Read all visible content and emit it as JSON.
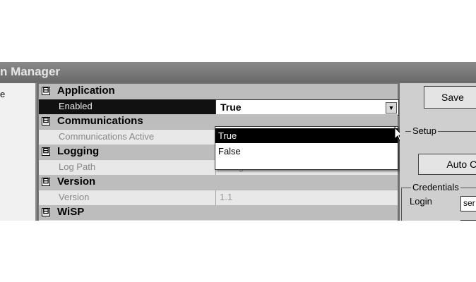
{
  "window": {
    "title": "n Manager"
  },
  "left_panel": {
    "text": "e"
  },
  "grid": {
    "categories": [
      {
        "name": "Application",
        "expander": "⊟"
      },
      {
        "name": "Communications",
        "expander": "⊟"
      },
      {
        "name": "Logging",
        "expander": "⊟"
      },
      {
        "name": "Version",
        "expander": "⊟"
      },
      {
        "name": "WiSP",
        "expander": "⊟"
      }
    ],
    "properties": {
      "enabled": {
        "name": "Enabled",
        "value": "True"
      },
      "communications_active": {
        "name": "Communications Active",
        "value": ""
      },
      "log_path": {
        "name": "Log Path",
        "value": "D:\\logs"
      },
      "version": {
        "name": "Version",
        "value": "1.1"
      }
    },
    "dropdown": {
      "options": [
        "True",
        "False"
      ],
      "selected": "True"
    }
  },
  "right_panel": {
    "save_label": "Save",
    "setup_label": "Setup",
    "auto_label": "Auto Co",
    "credentials_label": "Credentials",
    "login_label": "Login",
    "login_value": "ser"
  }
}
